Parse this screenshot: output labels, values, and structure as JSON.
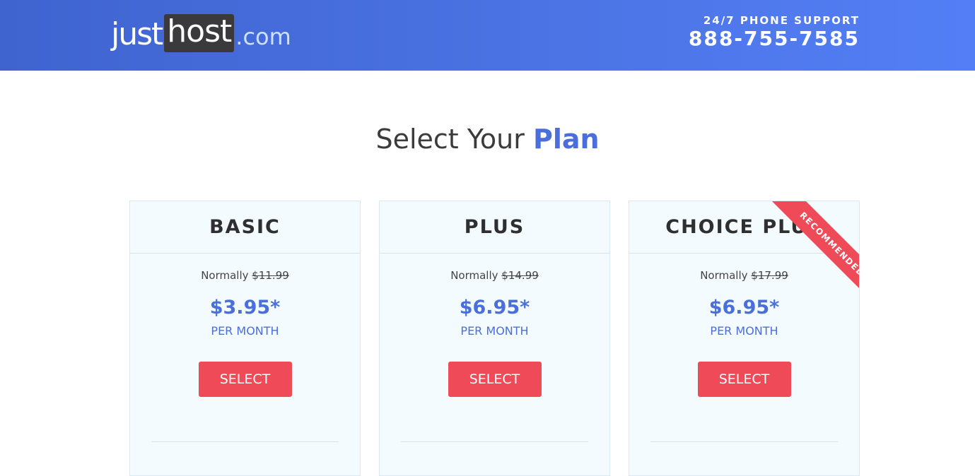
{
  "header": {
    "logo": {
      "part1": "just",
      "part2": "host",
      "part3": ".com"
    },
    "support_label": "24/7 PHONE SUPPORT",
    "support_phone": "888-755-7585"
  },
  "title": {
    "prefix": "Select Your ",
    "accent": "Plan"
  },
  "plans": [
    {
      "name": "BASIC",
      "normally_label": "Normally ",
      "normal_price": "$11.99",
      "price": "$3.95*",
      "period": "PER MONTH",
      "button": "SELECT"
    },
    {
      "name": "PLUS",
      "normally_label": "Normally ",
      "normal_price": "$14.99",
      "price": "$6.95*",
      "period": "PER MONTH",
      "button": "SELECT"
    },
    {
      "name": "CHOICE PLUS",
      "normally_label": "Normally ",
      "normal_price": "$17.99",
      "price": "$6.95*",
      "period": "PER MONTH",
      "button": "SELECT",
      "ribbon": "RECOMMENDED"
    }
  ],
  "colors": {
    "header_start": "#3f64d0",
    "header_end": "#537ff6",
    "accent": "#4a6edb",
    "button": "#ef4a57",
    "card_bg": "#f3fbfe"
  }
}
